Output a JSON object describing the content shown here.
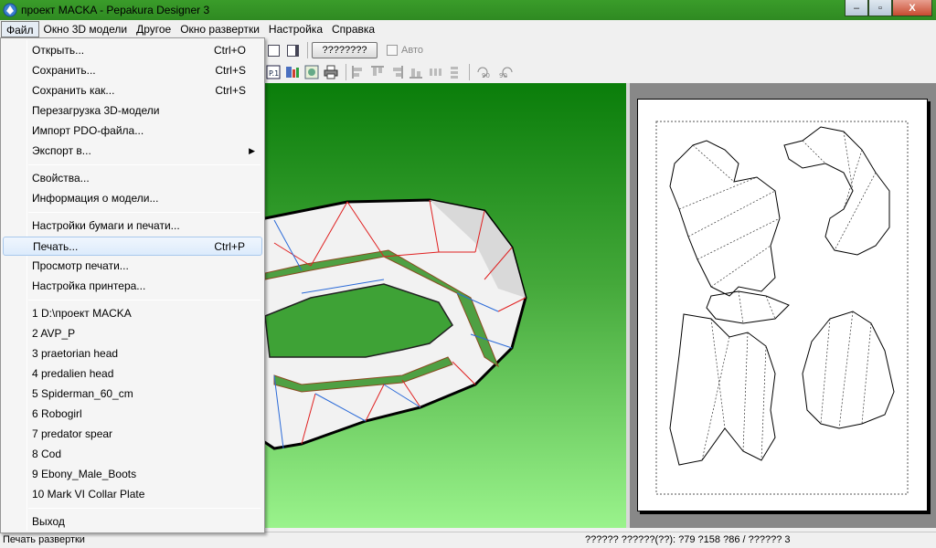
{
  "window": {
    "title": "проект MACKA - Pepakura Designer 3",
    "min_label": "‒",
    "max_label": "▫",
    "close_label": "X"
  },
  "menubar": [
    "Файл",
    "Окно 3D модели",
    "Другое",
    "Окно развертки",
    "Настройка",
    "Справка"
  ],
  "toolbar": {
    "qbutton_label": "????????",
    "auto_label": "Авто",
    "rot_left_label": "90",
    "rot_right_label": "90"
  },
  "file_menu": {
    "items": [
      {
        "label": "Открыть...",
        "shortcut": "Ctrl+O"
      },
      {
        "label": "Сохранить...",
        "shortcut": "Ctrl+S"
      },
      {
        "label": "Сохранить как...",
        "shortcut": "Ctrl+S"
      },
      {
        "label": "Перезагрузка 3D-модели",
        "shortcut": ""
      },
      {
        "label": "Импорт PDO-файла...",
        "shortcut": ""
      },
      {
        "label": "Экспорт в...",
        "shortcut": ""
      },
      {
        "label": "Свойства...",
        "shortcut": ""
      },
      {
        "label": "Информация о модели...",
        "shortcut": ""
      },
      {
        "label": "Настройки бумаги и печати...",
        "shortcut": ""
      },
      {
        "label": "Печать...",
        "shortcut": "Ctrl+P"
      },
      {
        "label": "Просмотр печати...",
        "shortcut": ""
      },
      {
        "label": "Настройка принтера...",
        "shortcut": ""
      },
      {
        "label": "1 D:\\проект MACKA",
        "shortcut": ""
      },
      {
        "label": "2 AVP_P",
        "shortcut": ""
      },
      {
        "label": "3 praetorian head",
        "shortcut": ""
      },
      {
        "label": "4 predalien head",
        "shortcut": ""
      },
      {
        "label": "5 Spiderman_60_cm",
        "shortcut": ""
      },
      {
        "label": "6 Robogirl",
        "shortcut": ""
      },
      {
        "label": "7 predator spear",
        "shortcut": ""
      },
      {
        "label": "8 Cod",
        "shortcut": ""
      },
      {
        "label": "9 Ebony_Male_Boots",
        "shortcut": ""
      },
      {
        "label": "10 Mark VI Collar Plate",
        "shortcut": ""
      },
      {
        "label": "Выход",
        "shortcut": ""
      }
    ],
    "submenu_arrow": "▶"
  },
  "statusbar": {
    "left": "Печать развертки",
    "right": "?????? ??????(??): ?79 ?158 ?86 / ?????? 3"
  },
  "colors": {
    "titlebar": "#3a9c2a",
    "viewport_top": "#0a7d0a",
    "viewport_bottom": "#9af38c",
    "highlight": "#dcebfc"
  }
}
